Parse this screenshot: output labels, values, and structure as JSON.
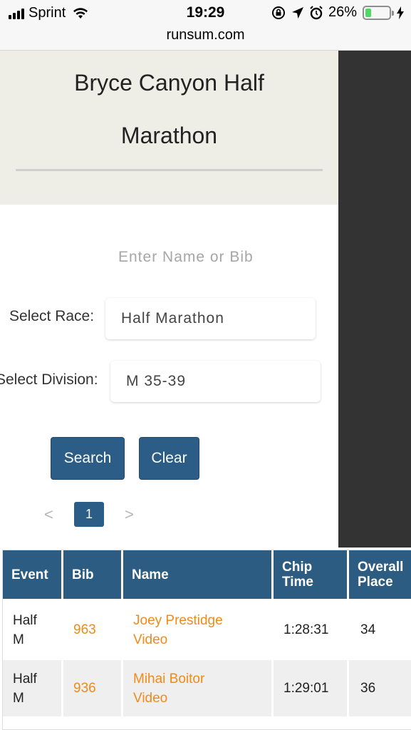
{
  "status_bar": {
    "carrier": "Sprint",
    "time": "19:29",
    "battery_percent": "26%",
    "battery_level": 0.26
  },
  "browser": {
    "url": "runsum.com"
  },
  "header": {
    "title_line1": "Bryce Canyon Half",
    "title_line2": "Marathon"
  },
  "search": {
    "name_placeholder": "Enter Name or Bib",
    "race_label": "Select Race:",
    "race_value": "Half Marathon",
    "division_label": "Select Division:",
    "division_value": "M 35-39",
    "search_button": "Search",
    "clear_button": "Clear"
  },
  "pagination": {
    "prev": "<",
    "current": "1",
    "next": ">"
  },
  "table": {
    "headers": {
      "event": "Event",
      "bib": "Bib",
      "name": "Name",
      "chip_time_line1": "Chip",
      "chip_time_line2": "Time",
      "overall_place_line1": "Overall",
      "overall_place_line2": "Place"
    },
    "rows": [
      {
        "event_line1": "Half",
        "event_line2": "M",
        "bib": "963",
        "name": "Joey Prestidge",
        "video": "Video",
        "chip_time": "1:28:31",
        "overall_place": "34"
      },
      {
        "event_line1": "Half",
        "event_line2": "M",
        "bib": "936",
        "name": "Mihai Boitor",
        "video": "Video",
        "chip_time": "1:29:01",
        "overall_place": "36"
      }
    ]
  },
  "colors": {
    "accent_blue": "#2b5d86",
    "link_orange": "#f08a19",
    "header_bg": "#eeede6",
    "dark_panel": "#333333"
  }
}
